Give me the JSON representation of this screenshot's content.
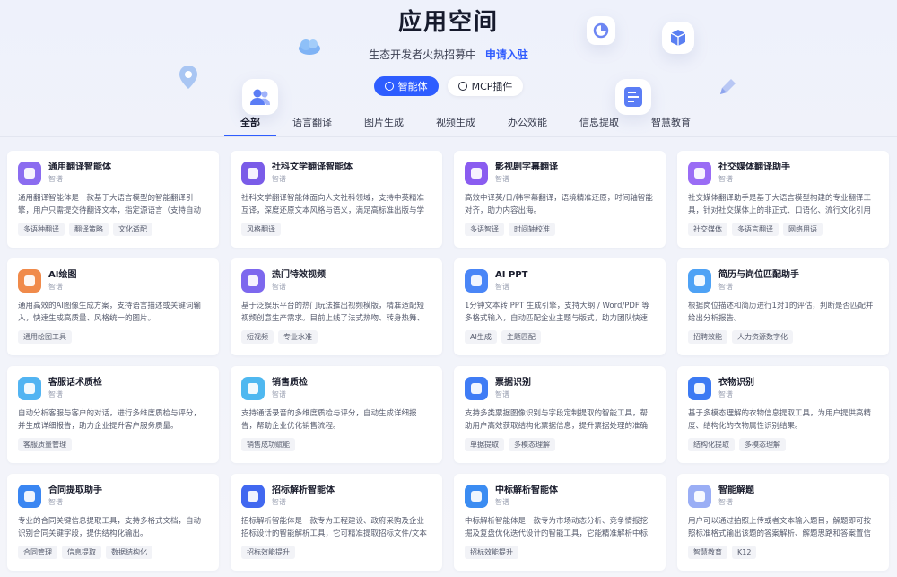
{
  "header": {
    "title": "应用空间",
    "subtitle": "生态开发者火热招募中",
    "apply_link": "申请入驻"
  },
  "type_switch": {
    "agent_label": "智能体",
    "mcp_label": "MCP插件"
  },
  "tabs": [
    "全部",
    "语言翻译",
    "图片生成",
    "视频生成",
    "办公效能",
    "信息提取",
    "智慧教育"
  ],
  "colors": {
    "accent": "#2e5dff",
    "page_bg": "#eef1fb"
  },
  "apps": [
    {
      "name": "通用翻译智能体",
      "category": "智谱",
      "icon": "translate-icon",
      "color": "#8b6cf0",
      "desc": "通用翻译智能体是一款基于大语言模型的智能翻译引擎，用户只需提交待翻译文本，指定源语言（支持自动检测）和…",
      "tags": [
        "多语种翻译",
        "翻译策略",
        "文化适配"
      ]
    },
    {
      "name": "社科文学翻译智能体",
      "category": "智谱",
      "icon": "book-icon",
      "color": "#7a5ce8",
      "desc": "社科文学翻译智能体面向人文社科领域，支持中英精准互译，深度还原文本风格与语义，满足高标准出版与学术翻…",
      "tags": [
        "风格翻译"
      ]
    },
    {
      "name": "影视剧字幕翻译",
      "category": "智谱",
      "icon": "subtitle-icon",
      "color": "#8a5cf0",
      "desc": "高效中译英/日/韩字幕翻译，语境精准还原，时间轴智能对齐，助力内容出海。",
      "tags": [
        "多语智译",
        "时间轴校准"
      ]
    },
    {
      "name": "社交媒体翻译助手",
      "category": "智谱",
      "icon": "social-icon",
      "color": "#9a6cf5",
      "desc": "社交媒体翻译助手是基于大语言模型构建的专业翻译工具，针对社交媒体上的非正式、口语化、流行文化引用和…",
      "tags": [
        "社交媒体",
        "多语言翻译",
        "网络用语"
      ]
    },
    {
      "name": "AI绘图",
      "category": "智谱",
      "icon": "brush-icon",
      "color": "#f08a4a",
      "desc": "通用高效的AI图像生成方案，支持语言描述或关键词输入，快速生成高质量、风格统一的图片。",
      "tags": [
        "通用绘图工具"
      ]
    },
    {
      "name": "热门特效视频",
      "category": "智谱",
      "icon": "planet-icon",
      "color": "#7d68ee",
      "desc": "基于泛娱乐平台的热门玩法推出视频模版，精准适配短视频创意生产需求。目前上线了法式热吻、转身热舞、变身比…",
      "tags": [
        "短视频",
        "专业水准"
      ]
    },
    {
      "name": "AI PPT",
      "category": "智谱",
      "icon": "ppt-icon",
      "color": "#4a86f7",
      "desc": "1分钟文本转 PPT 生成引擎，支持大纲 / Word/PDF 等多格式输入，自动匹配企业主题与版式，助力团队快速输出…",
      "tags": [
        "AI生成",
        "主题匹配"
      ]
    },
    {
      "name": "简历与岗位匹配助手",
      "category": "智谱",
      "icon": "resume-icon",
      "color": "#4ea2f5",
      "desc": "根据岗位描述和简历进行1对1的评估，判断是否匹配并给出分析报告。",
      "tags": [
        "招聘效能",
        "人力资源数字化"
      ]
    },
    {
      "name": "客服话术质检",
      "category": "智谱",
      "icon": "headset-icon",
      "color": "#52b4f2",
      "desc": "自动分析客服与客户的对话，进行多维度质检与评分，并生成详细报告，助力企业提升客户服务质量。",
      "tags": [
        "客服质量管理"
      ]
    },
    {
      "name": "销售质检",
      "category": "智谱",
      "icon": "chat-icon",
      "color": "#4fb8f0",
      "desc": "支持通话录音的多维度质检与评分，自动生成详细报告，帮助企业优化销售流程。",
      "tags": [
        "销售成功赋能"
      ]
    },
    {
      "name": "票据识别",
      "category": "智谱",
      "icon": "receipt-icon",
      "color": "#3f7cf5",
      "desc": "支持多类票据图像识别与字段定制提取的智能工具，帮助用户高效获取结构化票据信息，提升票据处理的准确性与自…",
      "tags": [
        "单据提取",
        "多模态理解"
      ]
    },
    {
      "name": "衣物识别",
      "category": "智谱",
      "icon": "shirt-icon",
      "color": "#3c7af3",
      "desc": "基于多模态理解的衣物信息提取工具，为用户提供高精度、结构化的衣物属性识别结果。",
      "tags": [
        "结构化提取",
        "多模态理解"
      ]
    },
    {
      "name": "合同提取助手",
      "category": "智谱",
      "icon": "contract-icon",
      "color": "#3a86f2",
      "desc": "专业的合同关键信息提取工具，支持多格式文档，自动识别合同关键字段，提供结构化输出。",
      "tags": [
        "合同管理",
        "信息提取",
        "数据结构化"
      ]
    },
    {
      "name": "招标解析智能体",
      "category": "智谱",
      "icon": "gavel-icon",
      "color": "#4168f0",
      "desc": "招标解析智能体是一款专为工程建设、政府采购及企业招标设计的智能解析工具，它可精准提取招标文件/文本信息…",
      "tags": [
        "招标效能提升"
      ]
    },
    {
      "name": "中标解析智能体",
      "category": "智谱",
      "icon": "send-icon",
      "color": "#3b8cf2",
      "desc": "中标解析智能体是一款专为市场动态分析、竞争情报挖掘及复盘优化迭代设计的智能工具，它能精准解析中标候选人…",
      "tags": [
        "招标效能提升"
      ]
    },
    {
      "name": "智能解题",
      "category": "智谱",
      "icon": "edu-icon",
      "color": "#9aaef5",
      "desc": "用户可以通过拍照上传或者文本输入题目，解题即可按照标准格式输出该题的答案解析、解题思路和答案置信度。",
      "tags": [
        "智慧教育",
        "K12"
      ]
    }
  ]
}
